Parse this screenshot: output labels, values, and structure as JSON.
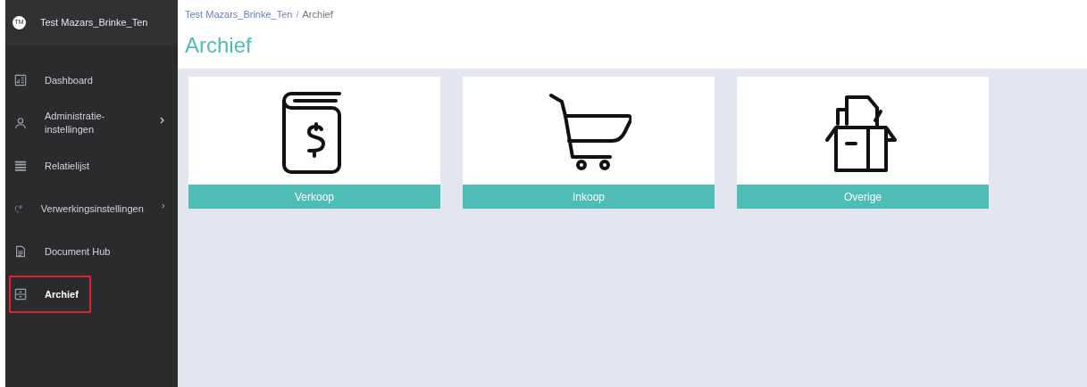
{
  "sidebar": {
    "avatar": "TM",
    "account": "Test Mazars_Brinke_Ten",
    "items": [
      {
        "kind": "dashboard",
        "label": "Dashboard",
        "has_submenu": false,
        "selected": false
      },
      {
        "kind": "admin",
        "label": "Administratie-\ninstellingen",
        "has_submenu": true,
        "selected": false
      },
      {
        "kind": "list",
        "label": "Relatielijst",
        "has_submenu": false,
        "selected": false
      },
      {
        "kind": "process",
        "label": "Verwerkingsinstellingen",
        "has_submenu": true,
        "selected": false
      },
      {
        "kind": "document",
        "label": "Document Hub",
        "has_submenu": false,
        "selected": false
      },
      {
        "kind": "archive",
        "label": "Archief",
        "has_submenu": false,
        "selected": true
      }
    ]
  },
  "breadcrumb_separator": "/",
  "breadcrumb": [
    {
      "label": "Test Mazars_Brinke_Ten"
    },
    {
      "label": "Archief"
    }
  ],
  "page_title": "Archief",
  "cards": [
    {
      "kind": "book",
      "label": "Verkoop"
    },
    {
      "kind": "cart",
      "label": "Inkoop"
    },
    {
      "kind": "box",
      "label": "Overige"
    }
  ]
}
